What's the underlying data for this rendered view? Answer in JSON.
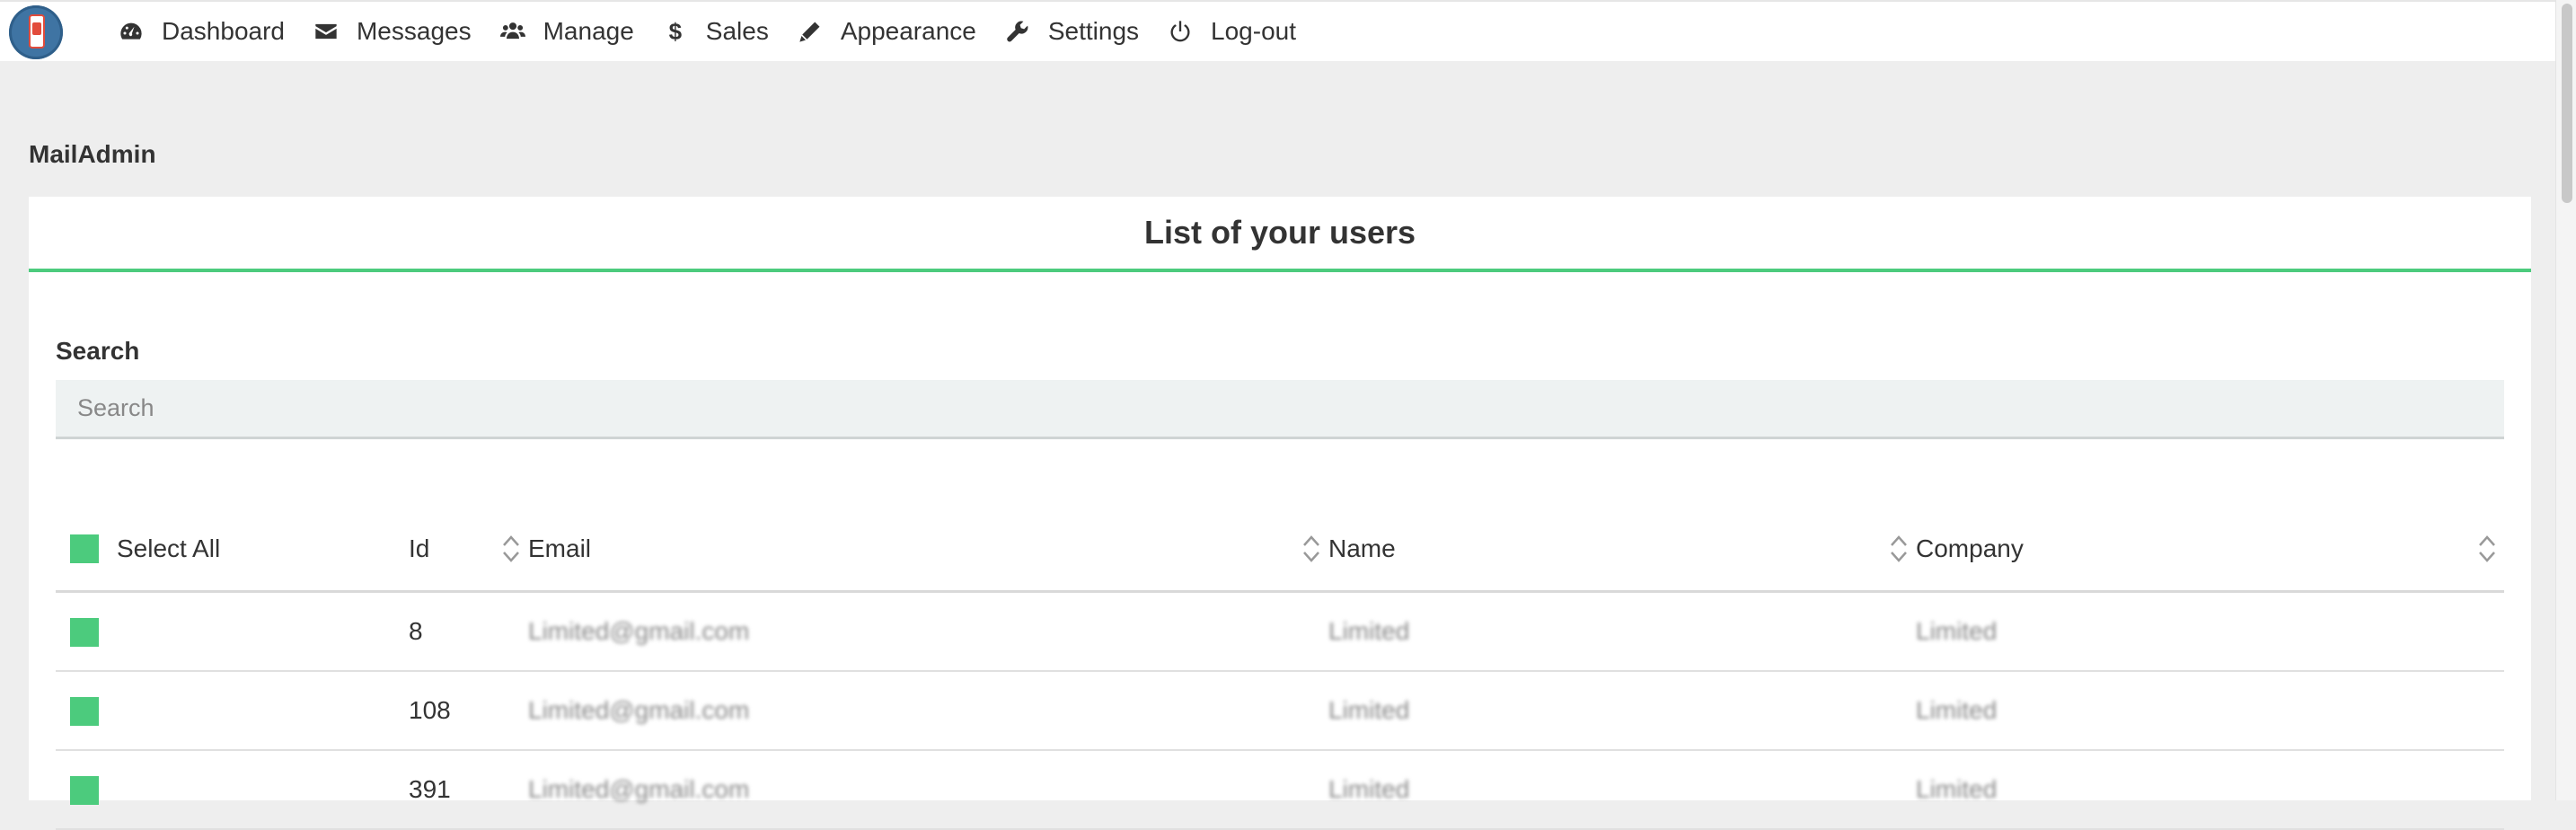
{
  "nav": {
    "items": [
      {
        "label": "Dashboard",
        "icon": "dashboard-icon"
      },
      {
        "label": "Messages",
        "icon": "envelope-icon"
      },
      {
        "label": "Manage",
        "icon": "users-icon"
      },
      {
        "label": "Sales",
        "icon": "dollar-icon"
      },
      {
        "label": "Appearance",
        "icon": "pencil-icon"
      },
      {
        "label": "Settings",
        "icon": "wrench-icon"
      },
      {
        "label": "Log-out",
        "icon": "power-icon"
      }
    ]
  },
  "page": {
    "heading": "MailAdmin"
  },
  "panel": {
    "title": "List of your users"
  },
  "search": {
    "label": "Search",
    "placeholder": "Search",
    "value": ""
  },
  "table": {
    "headers": {
      "select_all": "Select All",
      "id": "Id",
      "email": "Email",
      "name": "Name",
      "company": "Company"
    },
    "rows": [
      {
        "id": "8",
        "email": "Limited@gmail.com",
        "name": "Limited",
        "company": "Limited"
      },
      {
        "id": "108",
        "email": "Limited@gmail.com",
        "name": "Limited",
        "company": "Limited"
      },
      {
        "id": "391",
        "email": "Limited@gmail.com",
        "name": "Limited",
        "company": "Limited"
      }
    ]
  },
  "colors": {
    "accent": "#4ccb7d",
    "logo": "#3f74a3"
  }
}
